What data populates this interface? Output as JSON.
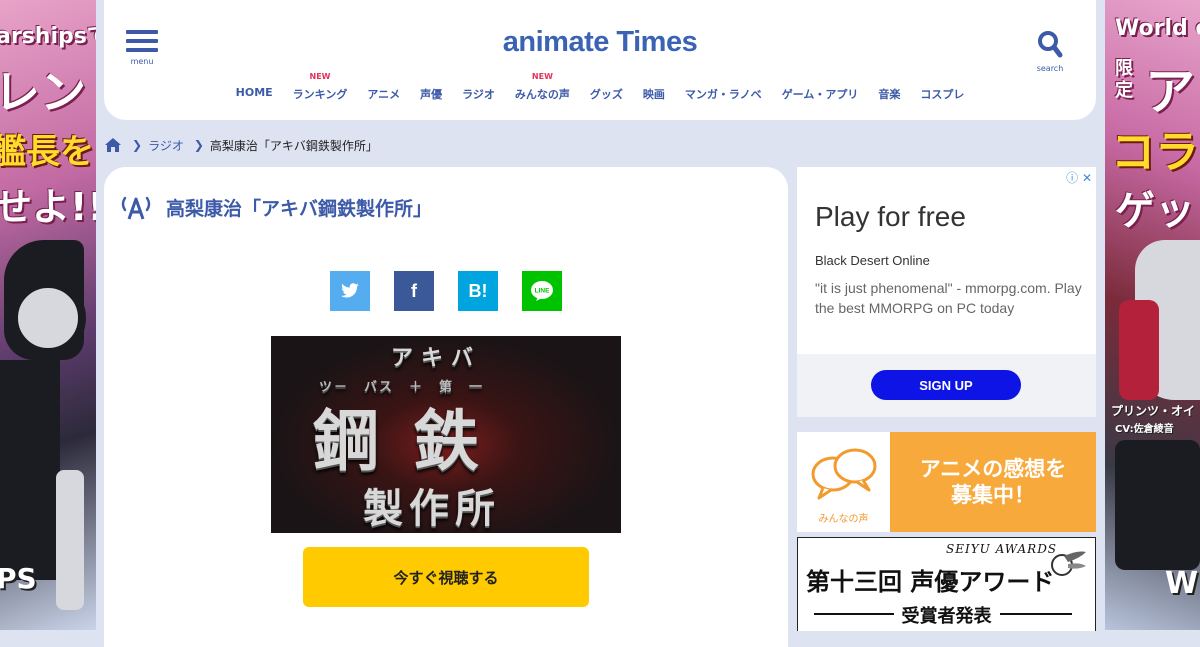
{
  "side_banners": {
    "left": {
      "lines": [
        "arshipsで",
        "レン",
        "艦長を",
        "せよ!!",
        "PS"
      ]
    },
    "right": {
      "lines": [
        "World o",
        "限定",
        "ア",
        "コラ",
        "ゲッ",
        "プリンツ・オイ",
        "CV:佐倉綾音",
        "W"
      ]
    }
  },
  "header": {
    "menu_label": "menu",
    "search_label": "search",
    "logo": {
      "part1": "an",
      "part2": "imate Times"
    },
    "nav": [
      {
        "label": "HOME",
        "badge": ""
      },
      {
        "label": "ランキング",
        "badge": "NEW"
      },
      {
        "label": "アニメ",
        "badge": ""
      },
      {
        "label": "声優",
        "badge": ""
      },
      {
        "label": "ラジオ",
        "badge": ""
      },
      {
        "label": "みんなの声",
        "badge": "NEW"
      },
      {
        "label": "グッズ",
        "badge": ""
      },
      {
        "label": "映画",
        "badge": ""
      },
      {
        "label": "マンガ・ラノベ",
        "badge": ""
      },
      {
        "label": "ゲーム・アプリ",
        "badge": ""
      },
      {
        "label": "音楽",
        "badge": ""
      },
      {
        "label": "コスプレ",
        "badge": ""
      }
    ]
  },
  "breadcrumb": {
    "category": "ラジオ",
    "current": "高梨康治「アキバ鋼鉄製作所」"
  },
  "article": {
    "title": "高梨康治「アキバ鋼鉄製作所」",
    "share": {
      "hatena": "B!",
      "facebook": "f",
      "line": "LINE"
    },
    "thumbnail": {
      "line1": "アキバ",
      "line2": "ツ－　バス　＋　第　一",
      "line3": "鋼鉄",
      "line4": "製作所"
    },
    "watch_button": "今すぐ視聴する"
  },
  "ad": {
    "title": "Play for free",
    "brand": "Black Desert Online",
    "description": "\"it is just phenomenal\" - mmorpg.com. Play the best MMORPG on PC today",
    "cta": "SIGN UP",
    "badge": "ⓘ ✕"
  },
  "impressions_banner": {
    "caption": "みんなの声",
    "line1": "アニメの感想を",
    "line2": "募集中！"
  },
  "awards_banner": {
    "top": "SEIYU AWARDS",
    "main": "第十三回 声優アワード",
    "sub": "受賞者発表"
  },
  "colors": {
    "brand_blue": "#3c5aa8",
    "new_badge": "#e0335b",
    "watch_button": "#ffcb00",
    "ad_cta": "#0f14e6",
    "impressions_orange": "#f7a93c"
  }
}
